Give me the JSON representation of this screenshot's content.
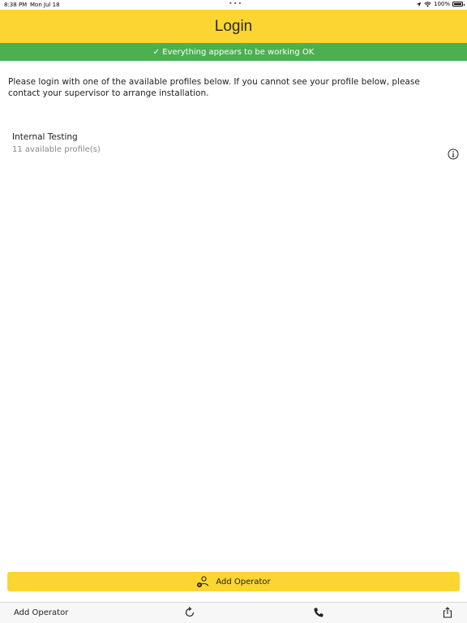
{
  "status_bar": {
    "time": "8:38 PM",
    "date": "Mon Jul 18",
    "battery": "100%"
  },
  "header": {
    "title": "Login"
  },
  "banner": {
    "text": "✓ Everything appears to be working OK",
    "color": "#4caf50"
  },
  "intro": {
    "text": "Please login with one of the available profiles below. If you cannot see your profile below, please contact your supervisor to arrange installation."
  },
  "profiles": [
    {
      "name": "Internal Testing",
      "count": "11 available profile(s)"
    }
  ],
  "actions": {
    "add_operator_label": "Add Operator"
  },
  "tabbar": {
    "add_operator_label": "Add Operator"
  },
  "colors": {
    "accent": "#fcd532",
    "success": "#4caf50"
  },
  "icons": [
    "wifi-icon",
    "location-icon",
    "battery-icon",
    "info-icon",
    "add-person-icon",
    "refresh-icon",
    "phone-icon",
    "share-icon"
  ]
}
